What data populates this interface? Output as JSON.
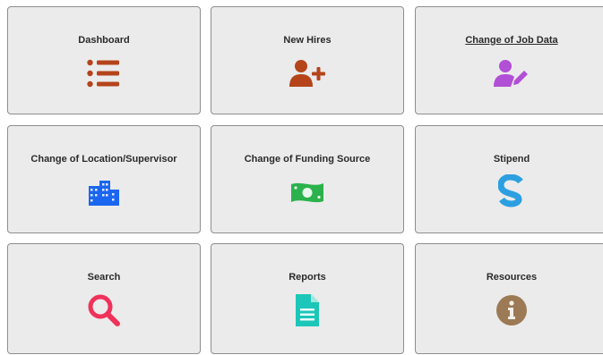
{
  "tiles": [
    {
      "label": "Dashboard",
      "icon": "list-icon",
      "color": "#b5441b"
    },
    {
      "label": "New Hires",
      "icon": "add-user-icon",
      "color": "#b5441b"
    },
    {
      "label": "Change of Job Data",
      "icon": "user-edit-icon",
      "color": "#b14fd6"
    },
    {
      "label": "Change of Location/Supervisor",
      "icon": "building-icon",
      "color": "#1b66f0"
    },
    {
      "label": "Change of Funding Source",
      "icon": "money-bill-icon",
      "color": "#2bb24c"
    },
    {
      "label": "Stipend",
      "icon": "stipend-s-icon",
      "color": "#2c9fe0"
    },
    {
      "label": "Search",
      "icon": "search-icon",
      "color": "#f0325a"
    },
    {
      "label": "Reports",
      "icon": "document-icon",
      "color": "#1cc6b8"
    },
    {
      "label": "Resources",
      "icon": "info-icon",
      "color": "#9c7a55"
    }
  ]
}
